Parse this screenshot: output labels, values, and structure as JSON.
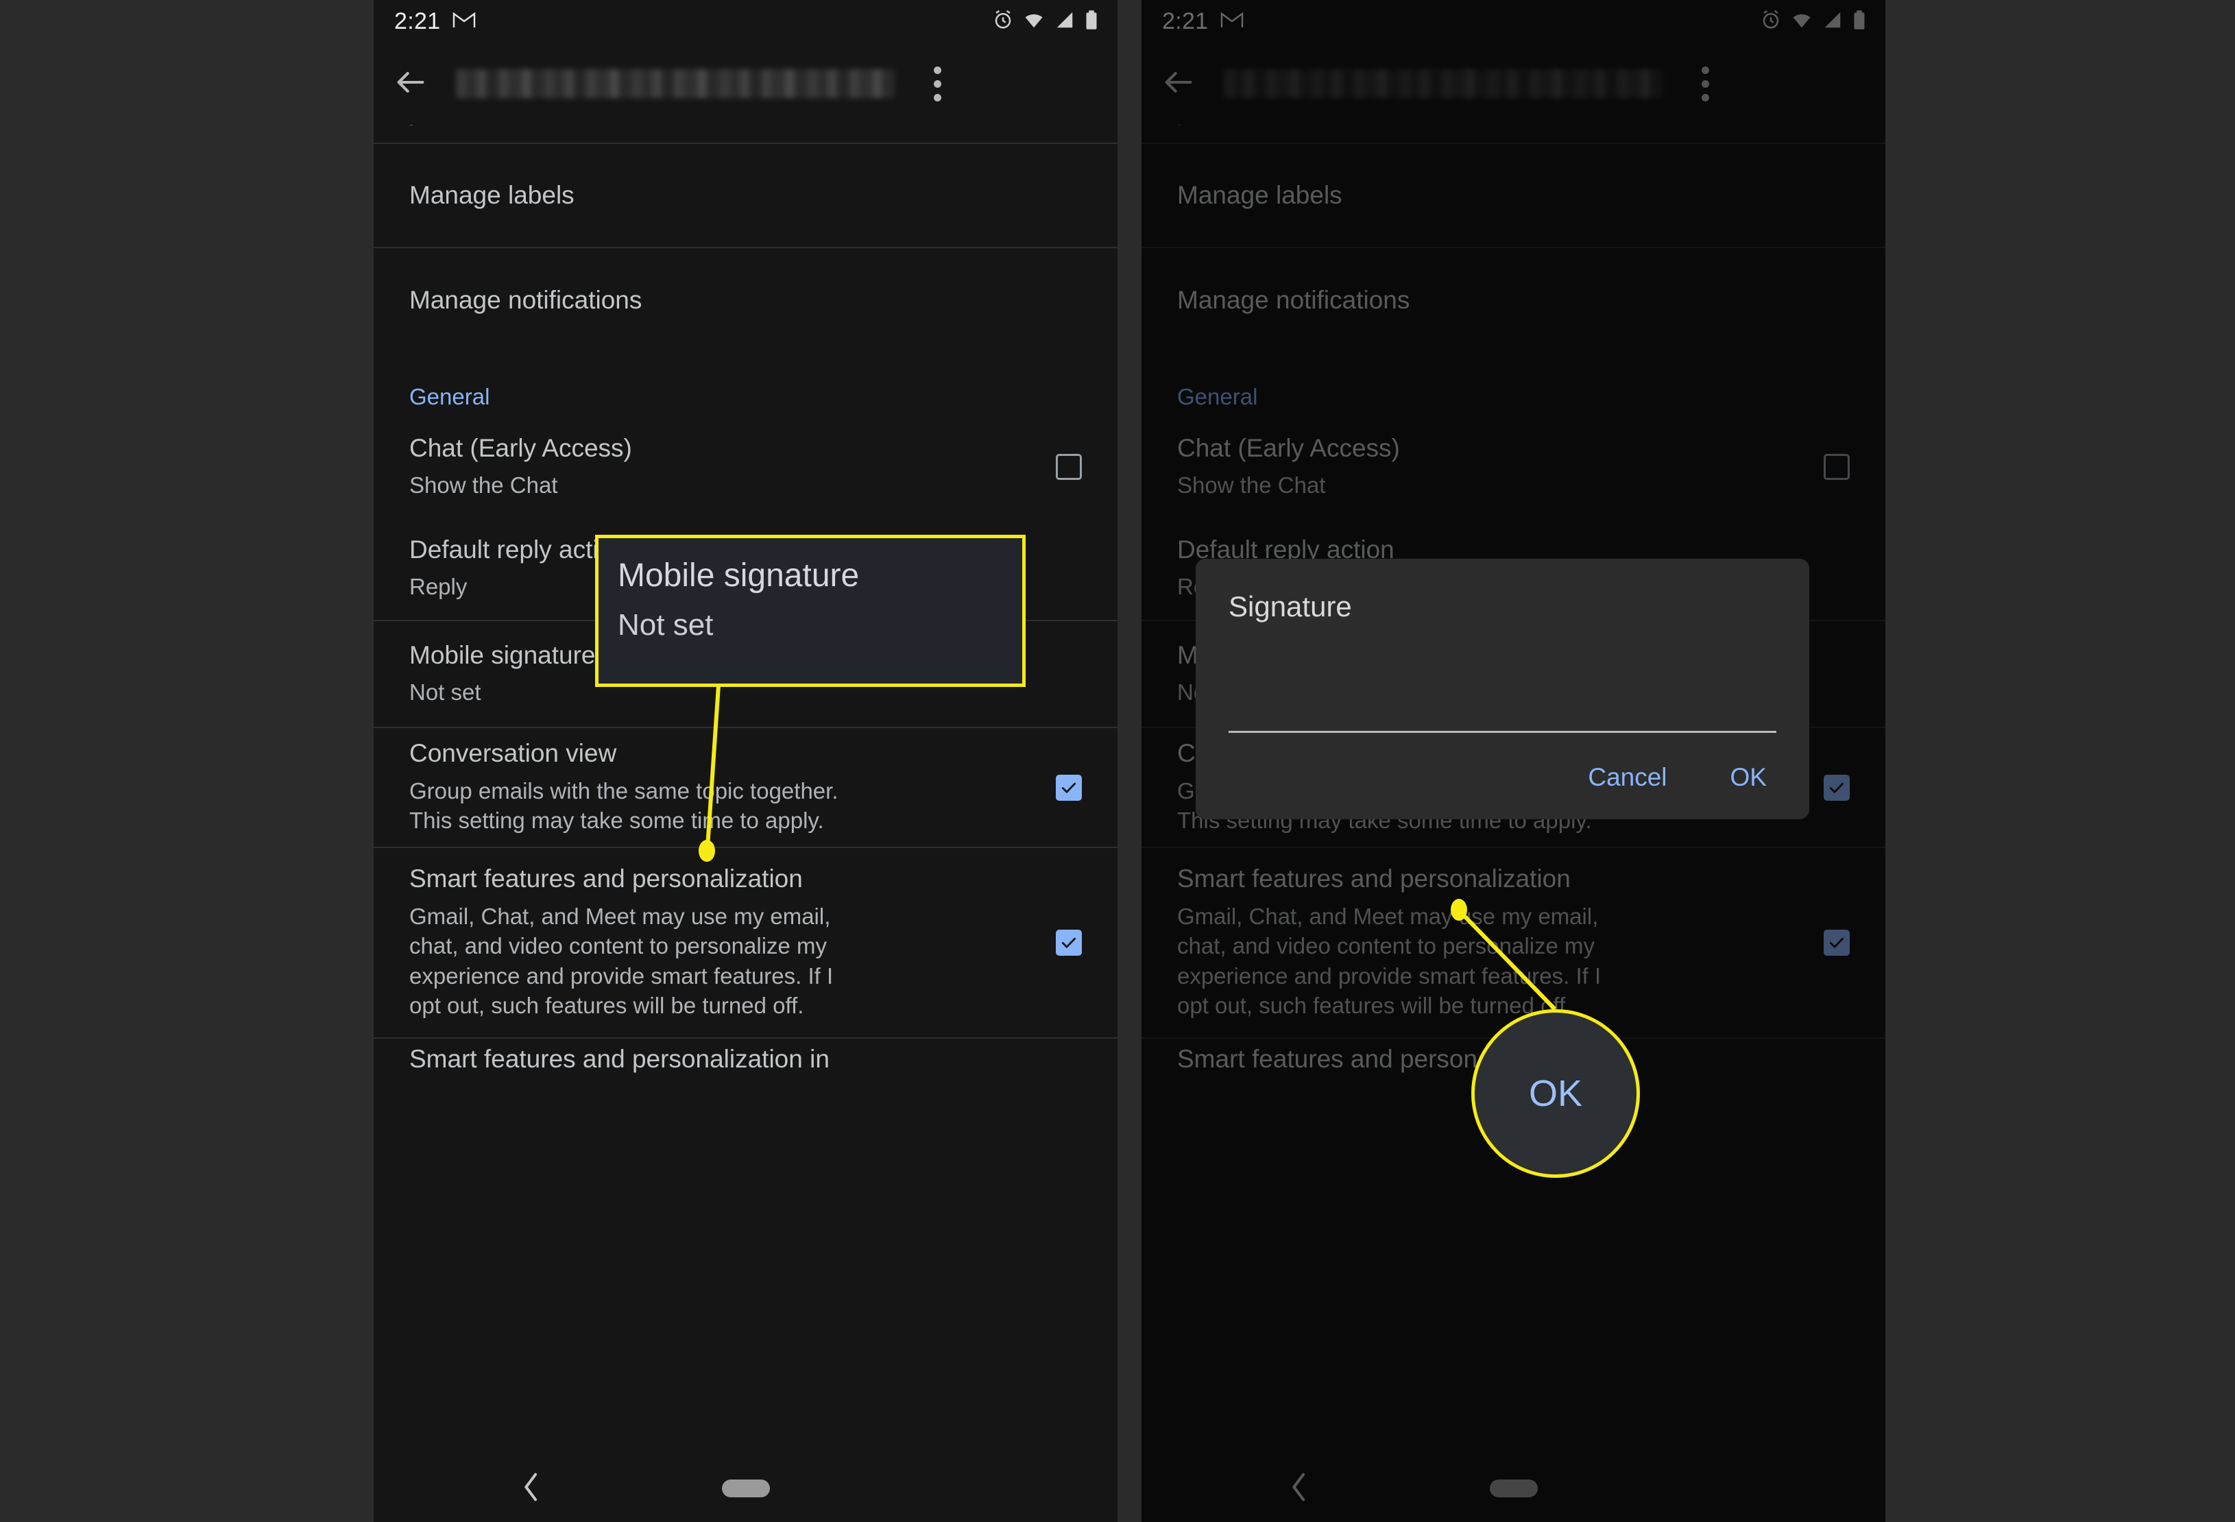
{
  "status_bar": {
    "time": "2:21",
    "app_icon": "gmail-m-icon",
    "icons": [
      "alarm-icon",
      "wifi-icon",
      "signal-icon",
      "battery-icon"
    ]
  },
  "app_bar": {
    "back": "back-arrow-icon",
    "account_title_blurred": "",
    "overflow": "overflow-menu-icon"
  },
  "settings": {
    "clipped_row_ghost": "y",
    "manage_labels": "Manage labels",
    "manage_notifications": "Manage notifications",
    "section_general": "General",
    "chat": {
      "title": "Chat (Early Access)",
      "subtitle": "Show the Chat",
      "checked": false
    },
    "default_reply": {
      "title": "Default reply action",
      "value": "Reply"
    },
    "mobile_signature": {
      "title": "Mobile signature",
      "value": "Not set"
    },
    "conversation_view": {
      "title": "Conversation view",
      "subtitle": "Group emails with the same topic together.\nThis setting may take some time to apply.",
      "checked": true
    },
    "smart_features": {
      "title": "Smart features and personalization",
      "subtitle": "Gmail, Chat, and Meet may use my email,\nchat, and video content to personalize my\nexperience and provide smart features. If I\nopt out, such features will be turned off.",
      "checked": true
    },
    "smart_features_in": "Smart features and personalization in"
  },
  "nav_bar": {
    "back": "nav-back-icon",
    "home": "home-pill-indicator"
  },
  "dialog": {
    "title": "Signature",
    "input_value": "",
    "cancel_label": "Cancel",
    "ok_label": "OK"
  },
  "annotations": {
    "callout_title": "Mobile signature",
    "callout_subtitle": "Not set",
    "magnifier_label": "OK",
    "highlight_color": "#f6eb14"
  },
  "colors": {
    "accent_blue": "#8ab4f8",
    "screen_bg": "#151515",
    "page_bg": "#2b2b2b",
    "dialog_bg": "#2c2c2c",
    "highlight": "#f6eb14"
  }
}
